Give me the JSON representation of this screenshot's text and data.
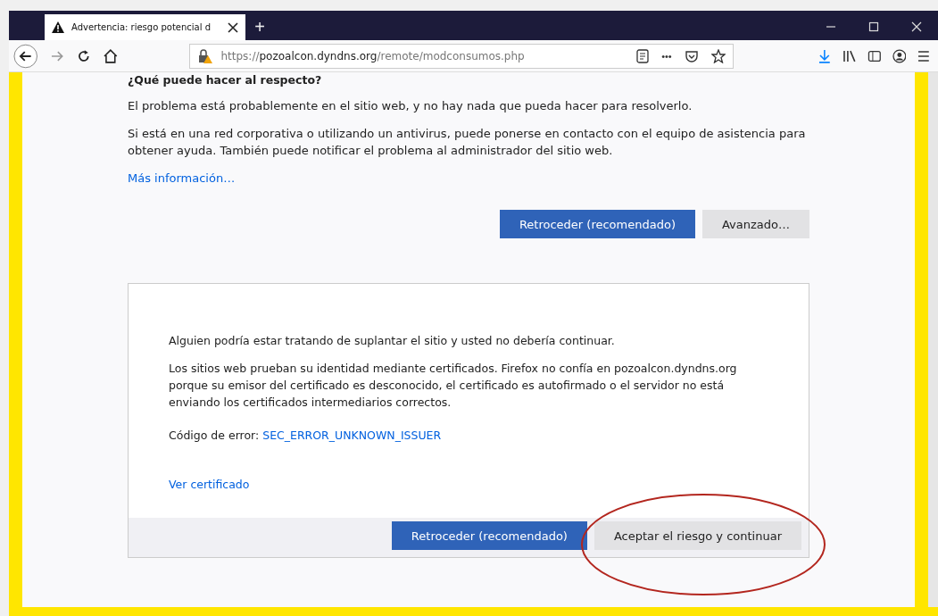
{
  "window": {
    "tab": {
      "title": "Advertencia: riesgo potencial d",
      "selected": true
    },
    "new_tab": "+"
  },
  "toolbar": {
    "url_scheme": "https://",
    "url_host": "pozoalcon.dyndns.org",
    "url_path": "/remote/modconsumos.php",
    "overflow": "•••"
  },
  "page": {
    "heading": "¿Qué puede hacer al respecto?",
    "paragraphs": [
      "El problema está probablemente en el sitio web, y no hay nada que pueda hacer para resolverlo.",
      "Si está en una red corporativa o utilizando un antivirus, puede ponerse en contacto con el equipo de asistencia para obtener ayuda. También puede notificar el problema al administrador del sitio web."
    ],
    "link": "Más información…",
    "buttons": [
      {
        "label": "Retroceder (recomendado)",
        "kind": "primary"
      },
      {
        "label": "Avanzado…",
        "kind": "secondary"
      }
    ]
  },
  "advanced": {
    "paragraphs": [
      "Alguien podría estar tratando de suplantar el sitio y usted no debería continuar.",
      "Los sitios web prueban su identidad mediante certificados. Firefox no confía en pozoalcon.dyndns.org porque su emisor del certificado es desconocido, el certificado es autofirmado o el servidor no está enviando los certificados intermediarios correctos."
    ],
    "error_label": "Código de error:",
    "error_code": "SEC_ERROR_UNKNOWN_ISSUER",
    "cert_link": "Ver certificado",
    "buttons": [
      {
        "label": "Retroceder (recomendado)",
        "kind": "primary"
      },
      {
        "label": "Aceptar el riesgo y continuar",
        "kind": "secondary"
      }
    ]
  }
}
